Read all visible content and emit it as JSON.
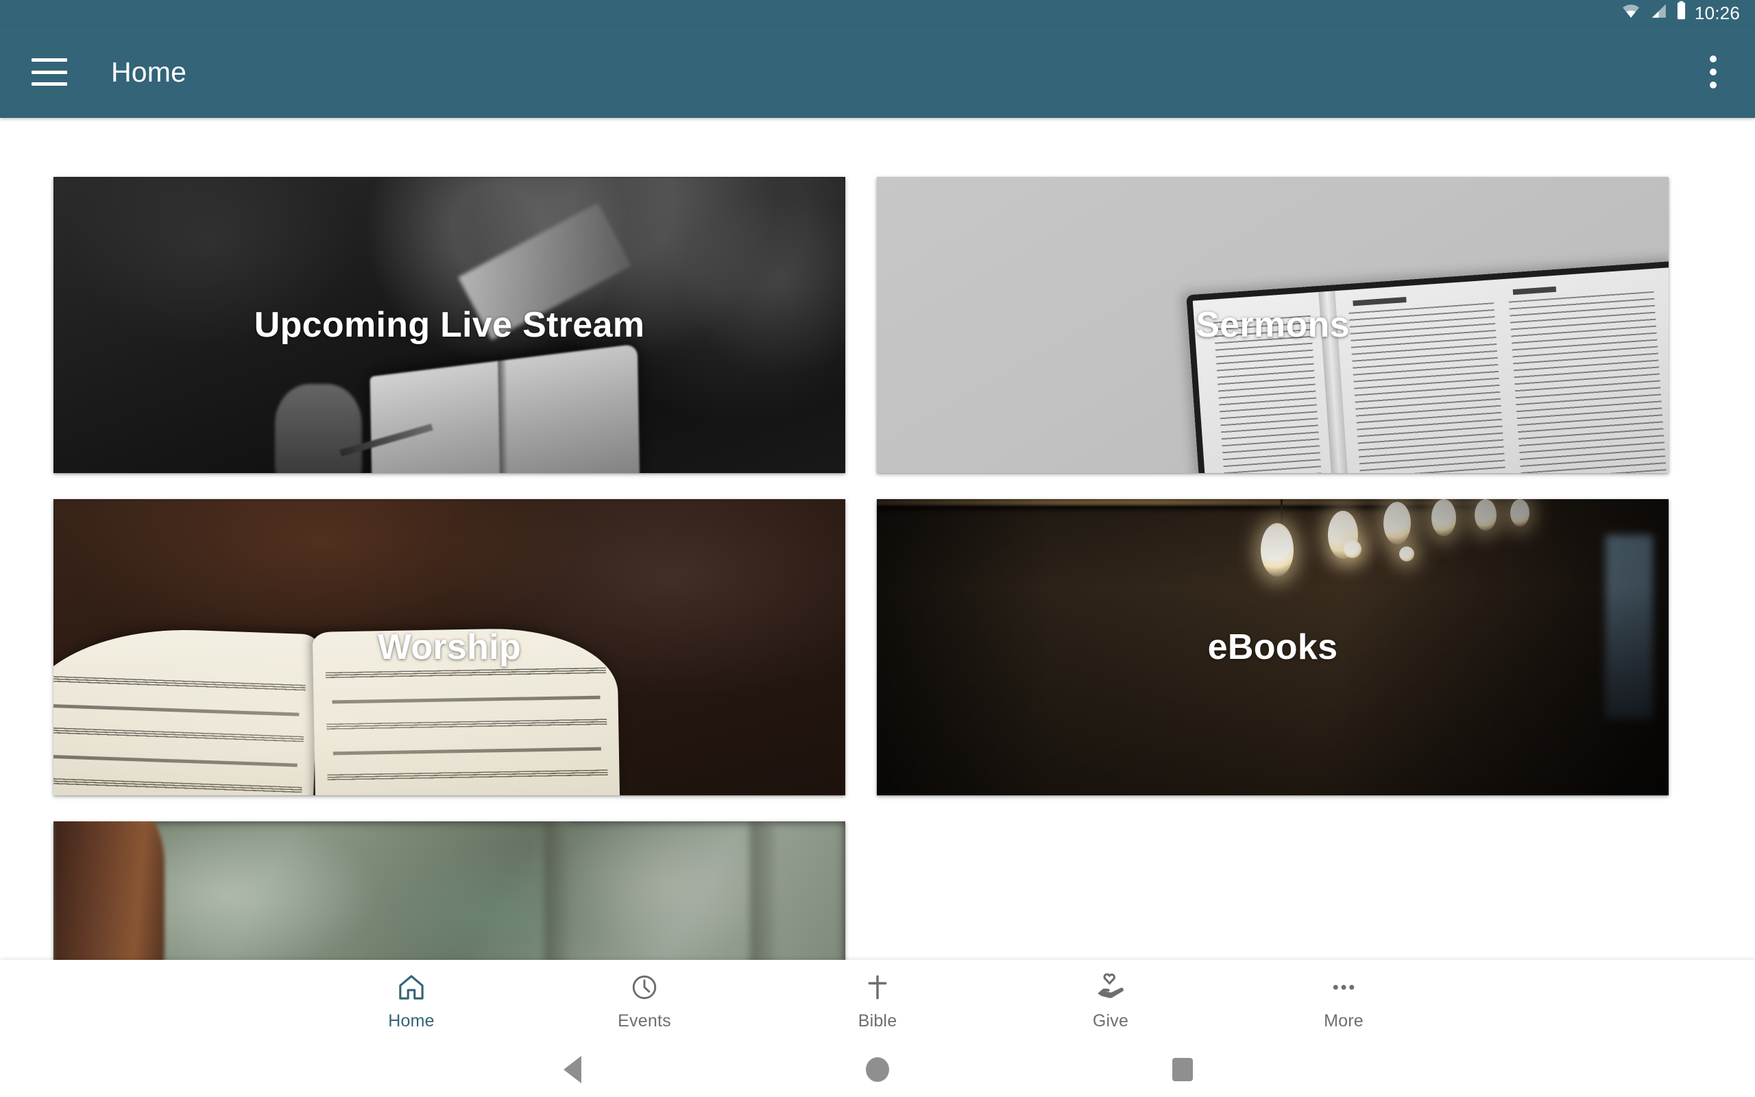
{
  "status_bar": {
    "time": "10:26",
    "icons": [
      "wifi-icon",
      "cellular-signal-icon",
      "battery-icon"
    ]
  },
  "app_bar": {
    "menu_icon": "hamburger-menu-icon",
    "title": "Home",
    "overflow_icon": "overflow-menu-icon",
    "background_color": "#336478",
    "text_color": "#ffffff"
  },
  "home_grid": {
    "cards": [
      {
        "label": "Upcoming Live Stream",
        "art": "dark-bw-person-with-open-book"
      },
      {
        "label": "Sermons",
        "art": "light-gray-open-bible-psalm-139"
      },
      {
        "label": "Worship",
        "art": "open-hymnal-sheet-music-dark-brown"
      },
      {
        "label": "eBooks",
        "art": "library-bookshelves-with-hanging-bulbs"
      },
      {
        "label": "",
        "art": "blurred-green-outdoor-scene-partial"
      }
    ]
  },
  "bottom_nav": {
    "active_color": "#336478",
    "inactive_color": "#6e6e6e",
    "items": [
      {
        "label": "Home",
        "icon": "house-icon",
        "active": true
      },
      {
        "label": "Events",
        "icon": "clock-icon",
        "active": false
      },
      {
        "label": "Bible",
        "icon": "cross-icon",
        "active": false
      },
      {
        "label": "Give",
        "icon": "hand-heart-icon",
        "active": false
      },
      {
        "label": "More",
        "icon": "more-dots-icon",
        "active": false
      }
    ]
  },
  "system_nav": {
    "buttons": [
      "back-triangle-icon",
      "home-circle-icon",
      "recents-square-icon"
    ]
  }
}
